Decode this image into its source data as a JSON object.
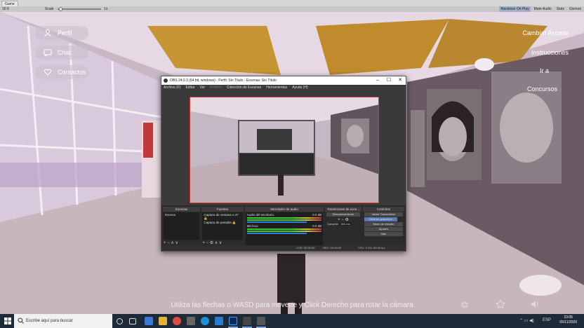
{
  "editor": {
    "tab_label": "Game",
    "display": "16:9",
    "scale_label": "Scale",
    "scale_value": "1x",
    "buttons": [
      "Maximize On Play",
      "Mute Audio",
      "Stats",
      "Gizmos"
    ]
  },
  "side_menu": [
    {
      "label": "Perfil",
      "icon": "user-icon"
    },
    {
      "label": "Chat",
      "icon": "chat-icon"
    },
    {
      "label": "Contactos",
      "icon": "heart-icon"
    }
  ],
  "right_menu": [
    "Cambiar Acceso",
    "Instrucciones",
    "Ir a",
    "Concursos"
  ],
  "hint": "Utiliza las flechas o WASD para moverte y Click Derecho para rotar la cámara",
  "obs": {
    "title": "OBS 24.0.3 (64 bit, windows) - Perfil: Sin Título - Escenas: Sin Título",
    "menu": [
      "Archivo (F)",
      "Editar",
      "Ver",
      "Perfiles",
      "Colección de Escenas",
      "Herramientas",
      "Ayuda (H)"
    ],
    "docks": {
      "scenes": {
        "header": "Escenas",
        "items": [
          "Escena"
        ]
      },
      "sources": {
        "header": "Fuentes",
        "items": [
          "Captura de ventana e.47 🔒",
          "Captura de pantalla 🔒"
        ]
      },
      "mixer": {
        "header": "Mezclador de audio",
        "channels": [
          {
            "name": "Audio del escritorio",
            "db": "0.0 dB"
          },
          {
            "name": "Mic/Aux",
            "db": "0.0 dB"
          }
        ]
      },
      "transitions": {
        "header": "Transiciones de esce...",
        "type": "Desvanecimiento",
        "duration_label": "Duración",
        "duration": "300 ms"
      },
      "controls": {
        "header": "Controles",
        "buttons": [
          "Iniciar Transmisión",
          "Detener grabación",
          "Modo de estudio",
          "Ajustes",
          "Salir"
        ]
      }
    },
    "status": {
      "live": "LIVE: 00:00:00",
      "rec": "REC: 00:00:00",
      "cpu": "CPU: 3.4%, 60.00 fps"
    }
  },
  "taskbar": {
    "search_placeholder": "Escribe aquí para buscar",
    "time": "23:05",
    "date": "05/11/2020",
    "lang": "ESP"
  },
  "colors": {
    "obs_border": "#dd3333",
    "taskbar": "#1f2a38",
    "record_active": "#5b7ab8"
  }
}
